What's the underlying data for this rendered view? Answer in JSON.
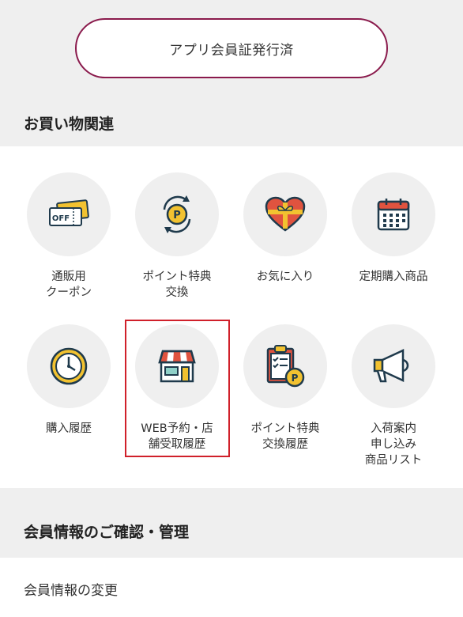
{
  "app_card_button": {
    "label": "アプリ会員証発行済"
  },
  "shopping_section": {
    "title": "お買い物関連",
    "items": [
      {
        "label": "通販用\nクーポン",
        "icon": "coupon-ticket-icon"
      },
      {
        "label": "ポイント特典\n交換",
        "icon": "point-exchange-icon"
      },
      {
        "label": "お気に入り",
        "icon": "heart-gift-icon"
      },
      {
        "label": "定期購入商品",
        "icon": "calendar-icon"
      },
      {
        "label": "購入履歴",
        "icon": "clock-icon"
      },
      {
        "label": "WEB予約・店\n舗受取履歴",
        "icon": "store-icon"
      },
      {
        "label": "ポイント特典\n交換履歴",
        "icon": "clipboard-point-icon"
      },
      {
        "label": "入荷案内\n申し込み\n商品リスト",
        "icon": "megaphone-icon"
      }
    ]
  },
  "member_section": {
    "title": "会員情報のご確認・管理",
    "rows": [
      {
        "label": "会員情報の変更"
      }
    ]
  },
  "coupon_icon_text": "OFF",
  "point_icon_text": "P",
  "colors": {
    "accent_border": "#8a1a4c",
    "highlight": "#d0202a",
    "icon_dark": "#1f3a4c",
    "icon_yellow": "#f2c230",
    "icon_red": "#e0533f",
    "icon_teal": "#8fd0c8"
  }
}
